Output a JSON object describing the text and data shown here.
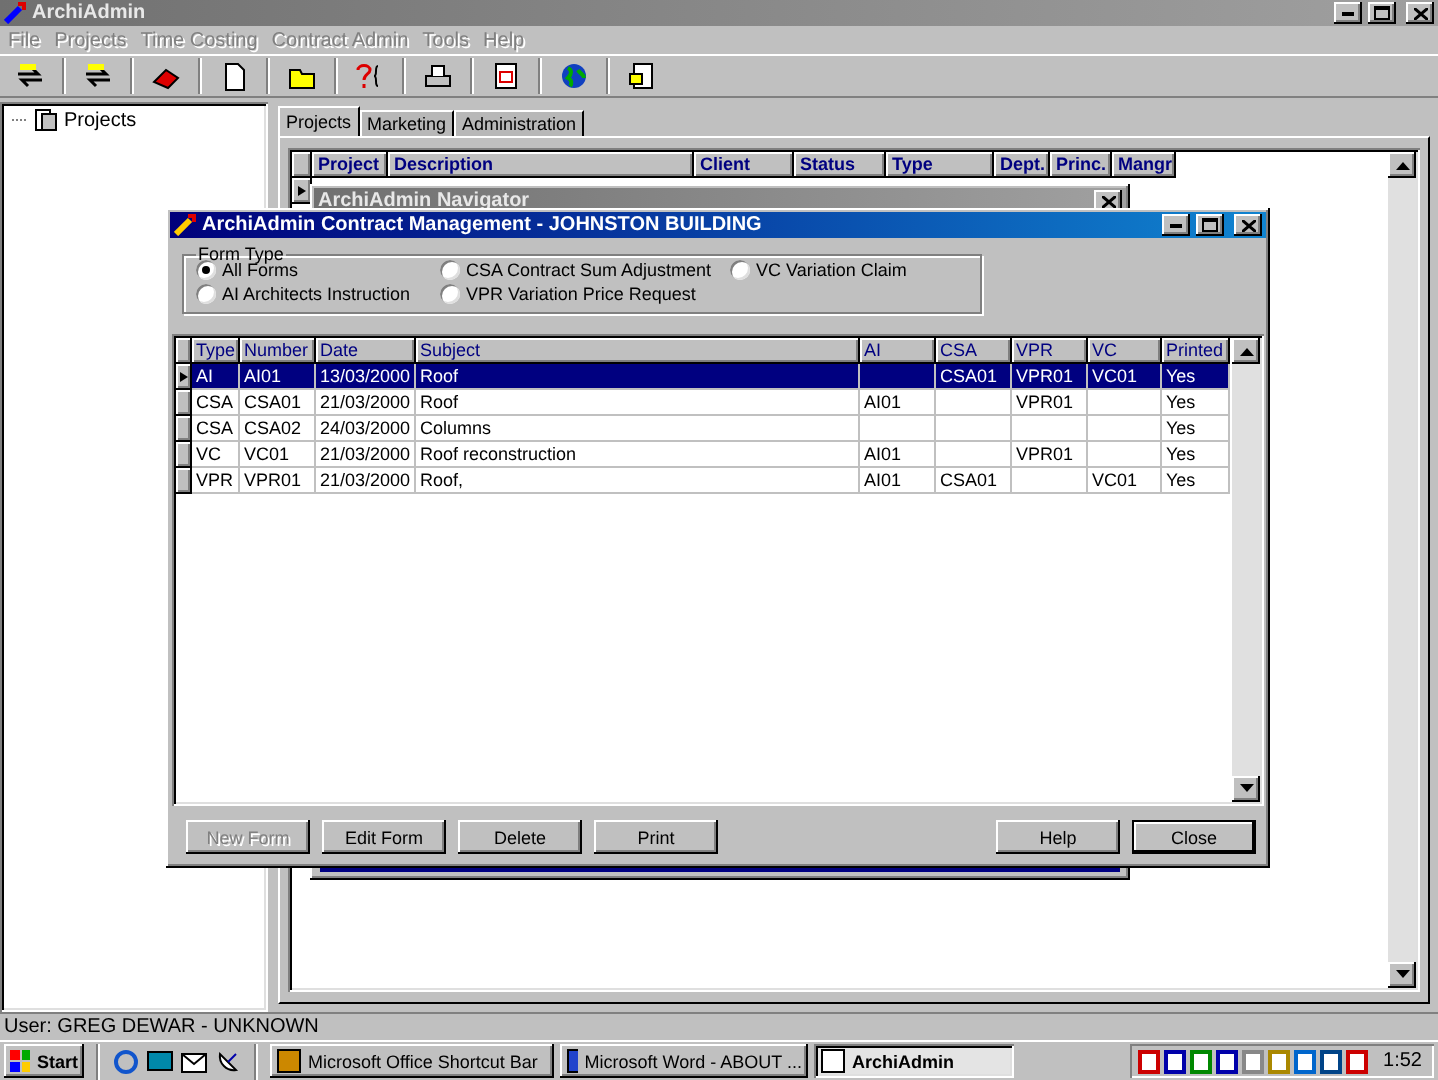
{
  "window": {
    "title": "ArchiAdmin"
  },
  "menu": [
    {
      "label": "File"
    },
    {
      "label": "Projects"
    },
    {
      "label": "Time Costing"
    },
    {
      "label": "Contract Admin"
    },
    {
      "label": "Tools"
    },
    {
      "label": "Help"
    }
  ],
  "toolbar": [
    {
      "kind": "swap"
    },
    {
      "kind": "swap"
    },
    {
      "kind": "eraser"
    },
    {
      "kind": "page"
    },
    {
      "kind": "folder"
    },
    {
      "kind": "query"
    },
    {
      "kind": "printer"
    },
    {
      "kind": "calendar"
    },
    {
      "kind": "globe"
    },
    {
      "kind": "report"
    }
  ],
  "tree": [
    {
      "label": "Projects"
    }
  ],
  "tabs": [
    {
      "label": "Projects",
      "selected": true
    },
    {
      "label": "Marketing",
      "selected": false
    },
    {
      "label": "Administration",
      "selected": false
    }
  ],
  "projects_grid": {
    "columns": [
      "Project",
      "Description",
      "Client",
      "Status",
      "Type",
      "Dept.",
      "Princ.",
      "Mangr"
    ]
  },
  "navigator": {
    "title": "ArchiAdmin Navigator"
  },
  "dialog": {
    "title": "ArchiAdmin Contract Management - JOHNSTON BUILDING",
    "group_title": "Form Type",
    "radios": [
      {
        "label": "All Forms",
        "selected": true
      },
      {
        "label": "AI Architects Instruction",
        "selected": false
      },
      {
        "label": "CSA Contract Sum Adjustment",
        "selected": false
      },
      {
        "label": "VPR Variation Price Request",
        "selected": false
      },
      {
        "label": "VC Variation Claim",
        "selected": false
      }
    ],
    "columns": [
      "Type",
      "Number",
      "Date",
      "Subject",
      "AI",
      "CSA",
      "VPR",
      "VC",
      "Printed"
    ],
    "rows": [
      {
        "selected": true,
        "cells": [
          "AI",
          "AI01",
          "13/03/2000",
          "Roof",
          "",
          "CSA01",
          "VPR01",
          "VC01",
          "Yes"
        ]
      },
      {
        "selected": false,
        "cells": [
          "CSA",
          "CSA01",
          "21/03/2000",
          "Roof",
          "AI01",
          "",
          "VPR01",
          "",
          "Yes"
        ]
      },
      {
        "selected": false,
        "cells": [
          "CSA",
          "CSA02",
          "24/03/2000",
          "Columns",
          "",
          "",
          "",
          "",
          "Yes"
        ]
      },
      {
        "selected": false,
        "cells": [
          "VC",
          "VC01",
          "21/03/2000",
          "Roof reconstruction",
          "AI01",
          "",
          "VPR01",
          "",
          "Yes"
        ]
      },
      {
        "selected": false,
        "cells": [
          "VPR",
          "VPR01",
          "21/03/2000",
          "Roof,",
          "AI01",
          "CSA01",
          "",
          "VC01",
          "Yes"
        ]
      }
    ],
    "left_buttons": [
      {
        "label": "New Form",
        "disabled": true,
        "default": false
      },
      {
        "label": "Edit Form",
        "disabled": false,
        "default": false
      },
      {
        "label": "Delete",
        "disabled": false,
        "default": false
      },
      {
        "label": "Print",
        "disabled": false,
        "default": false
      }
    ],
    "right_buttons": [
      {
        "label": "Help",
        "disabled": false,
        "default": false
      },
      {
        "label": "Close",
        "disabled": false,
        "default": true
      }
    ]
  },
  "status_bar": "User: GREG DEWAR - UNKNOWN",
  "taskbar": {
    "start": "Start",
    "tasks": [
      {
        "label": "Microsoft Office Shortcut Bar",
        "selected": false
      },
      {
        "label": "Microsoft Word - ABOUT ...",
        "selected": false
      },
      {
        "label": "ArchiAdmin",
        "selected": true
      }
    ],
    "clock": "1:52"
  }
}
